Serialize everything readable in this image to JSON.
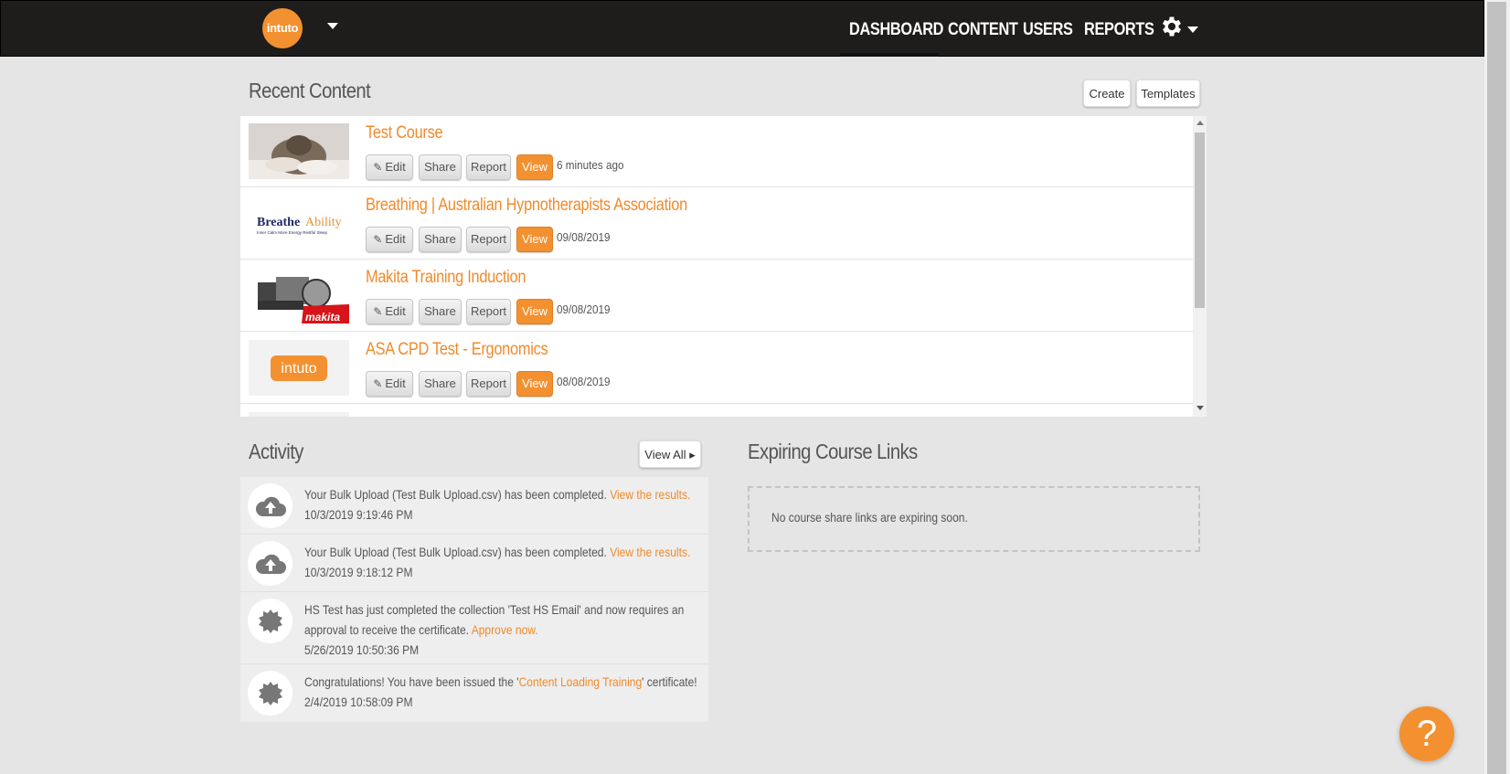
{
  "brand": {
    "logo_text": "intuto"
  },
  "nav": {
    "items": [
      {
        "label": "DASHBOARD",
        "active": true
      },
      {
        "label": "CONTENT"
      },
      {
        "label": "USERS"
      },
      {
        "label": "REPORTS"
      }
    ],
    "settings_icon": "gear-icon"
  },
  "recent_content": {
    "title": "Recent Content",
    "create_label": "Create",
    "templates_label": "Templates",
    "row_buttons": {
      "edit": "Edit",
      "share": "Share",
      "report": "Report",
      "view": "View"
    },
    "items": [
      {
        "title": "Test Course",
        "date": "6 minutes ago",
        "thumb": "cat-photo"
      },
      {
        "title": "Breathing | Australian Hypnotherapists Association",
        "date": "09/08/2019",
        "thumb": "breatheability-logo",
        "thumb_text_a": "Breathe",
        "thumb_text_b": "Ability",
        "thumb_tagline": "Inner Calm  More Energy  Restful Sleep"
      },
      {
        "title": "Makita Training Induction",
        "date": "09/08/2019",
        "thumb": "makita-tools",
        "thumb_text": "makita"
      },
      {
        "title": "ASA CPD Test - Ergonomics",
        "date": "08/08/2019",
        "thumb": "intuto-logo",
        "thumb_text": "intuto"
      }
    ]
  },
  "activity": {
    "title": "Activity",
    "view_all_label": "View All",
    "items": [
      {
        "icon": "cloud-upload-icon",
        "text": "Your Bulk Upload (Test Bulk Upload.csv) has been completed. ",
        "link": "View the results.",
        "time": "10/3/2019 9:19:46 PM"
      },
      {
        "icon": "cloud-upload-icon",
        "text": "Your Bulk Upload (Test Bulk Upload.csv) has been completed. ",
        "link": "View the results.",
        "time": "10/3/2019 9:18:12 PM"
      },
      {
        "icon": "badge-icon",
        "text_line1": "HS Test has just completed the collection 'Test HS Email' and now requires an",
        "text_line2": "approval to receive the certificate. ",
        "link": "Approve now.",
        "time": "5/26/2019 10:50:36 PM"
      },
      {
        "icon": "badge-icon",
        "text_pre": "Congratulations! You have been issued the '",
        "link": "Content Loading Training",
        "text_post": "' certificate!",
        "time": "2/4/2019 10:58:09 PM"
      }
    ]
  },
  "expiring": {
    "title": "Expiring Course Links",
    "empty_text": "No course share links are expiring soon."
  },
  "help": {
    "label": "?"
  },
  "colors": {
    "accent": "#f39131",
    "nav_bg": "#1f1d1c",
    "page_bg": "#e5e5e5"
  }
}
